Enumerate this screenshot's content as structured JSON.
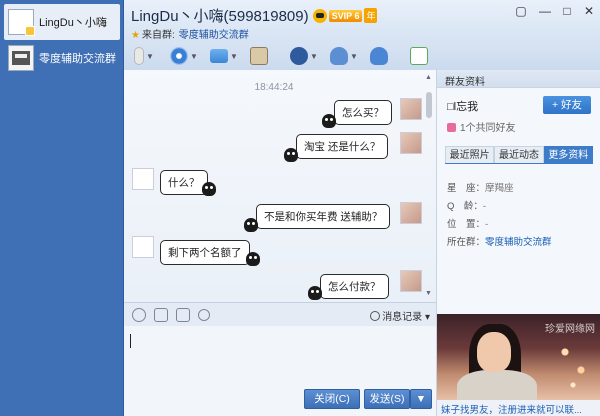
{
  "sidebar": {
    "items": [
      {
        "label": "LingDu丶小嗨"
      },
      {
        "label": "零度辅助交流群"
      }
    ]
  },
  "header": {
    "title": "LingDu丶小嗨(599819809)",
    "vip_label": "SVIP 6",
    "year_badge": "年",
    "from_prefix": "来自群:",
    "from_group": "零度辅助交流群"
  },
  "window": {
    "restore": "▢",
    "minimize": "—",
    "maximize": "□",
    "close": "✕"
  },
  "chat": {
    "timestamp": "18:44:24",
    "messages": [
      {
        "side": "me",
        "text": "怎么买？"
      },
      {
        "side": "me",
        "text": "淘宝 还是什么？"
      },
      {
        "side": "them",
        "text": "什么？"
      },
      {
        "side": "me",
        "text": "不是和你买年费 送辅助？"
      },
      {
        "side": "them",
        "text": "剩下两个名额了"
      },
      {
        "side": "me",
        "text": "怎么付款？"
      }
    ]
  },
  "input_tools": {
    "history_label": "消息记录"
  },
  "buttons": {
    "close": "关闭(C)",
    "send": "发送(S)"
  },
  "panel": {
    "header": "群友资料",
    "name": "□l忘我",
    "add_friend": "+ 好友",
    "common_friends": "1个共同好友",
    "tabs": [
      "最近照片",
      "最近动态",
      "更多资料"
    ],
    "info": {
      "constellation_label": "星　座：",
      "constellation_value": "摩羯座",
      "qage_label": "Q　龄：",
      "qage_value": "-",
      "location_label": "位　置：",
      "location_value": "-",
      "group_label": "所在群：",
      "group_value": "零度辅助交流群"
    },
    "ad_watermark": "珍爱网缘网",
    "ad_text": "妹子找男友，注册进来就可以联..."
  },
  "colors": {
    "sidebar_bg": "#3f6fb4",
    "accent": "#3d7cc9",
    "link": "#1a5fb4"
  }
}
